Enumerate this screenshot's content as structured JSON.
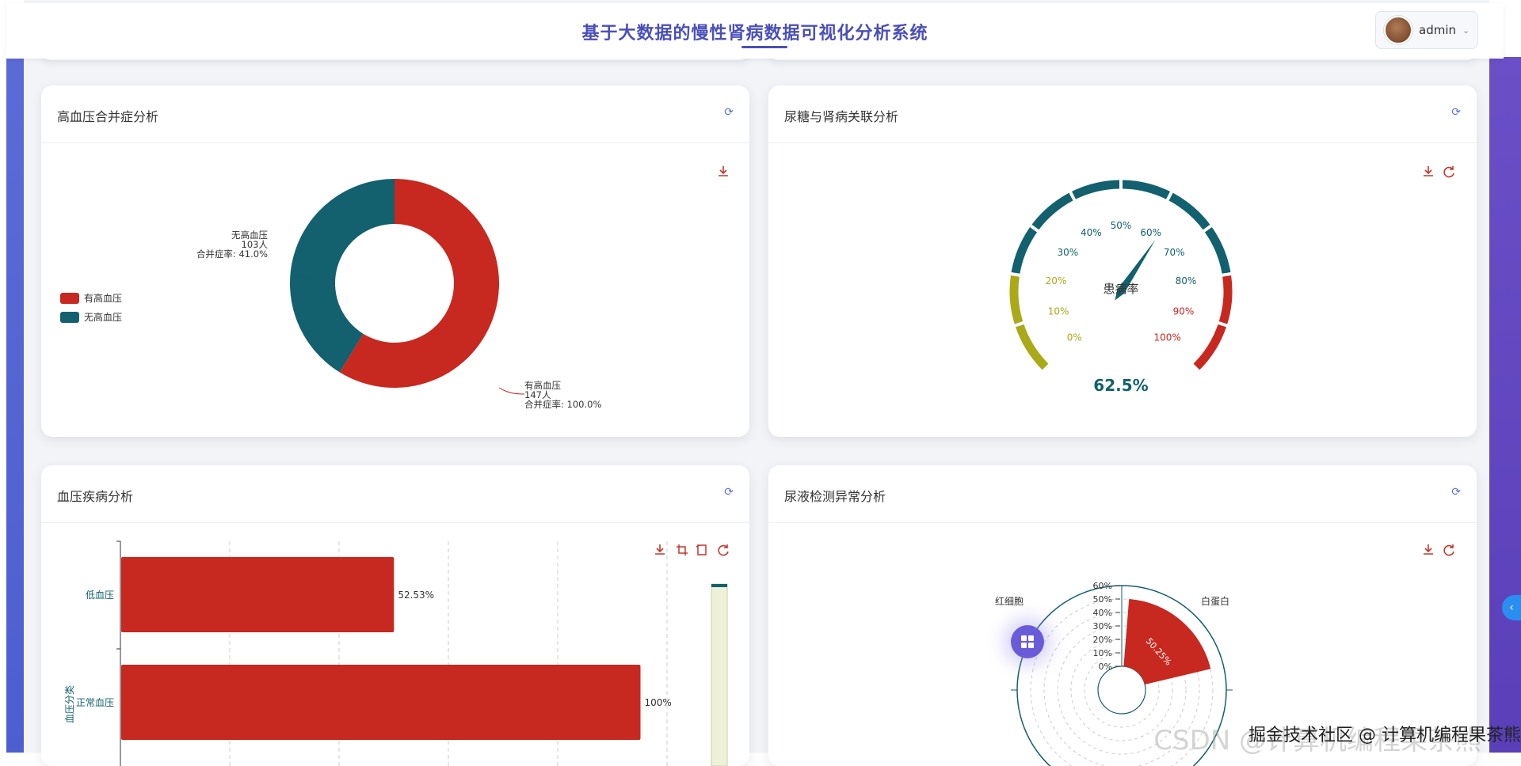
{
  "header": {
    "title": "基于大数据的慢性肾病数据可视化分析系统",
    "user_name": "admin"
  },
  "cards": {
    "hypertension": {
      "title": "高血压合并症分析",
      "legend": [
        {
          "label": "有高血压",
          "color": "#c7281f"
        },
        {
          "label": "无高血压",
          "color": "#13606e"
        }
      ],
      "labels": {
        "yes_name": "有高血压",
        "yes_count": "147人",
        "yes_rate": "合并症率: 100.0%",
        "no_name": "无高血压",
        "no_count": "103人",
        "no_rate": "合并症率: 41.0%"
      }
    },
    "glucose": {
      "title": "尿糖与肾病关联分析",
      "gauge_label": "患病率",
      "value_text": "62.5%",
      "ticks": [
        "0%",
        "10%",
        "20%",
        "30%",
        "40%",
        "50%",
        "60%",
        "70%",
        "80%",
        "90%",
        "100%"
      ]
    },
    "bp_disease": {
      "title": "血压疾病分析",
      "axis_title": "血压分类",
      "bars": [
        {
          "label": "低血压",
          "value_text": "52.53%"
        },
        {
          "label": "正常血压",
          "value_text": "100%"
        }
      ]
    },
    "urine": {
      "title": "尿液检测异常分析",
      "radial_labels": [
        "60%",
        "50%",
        "40%",
        "30%",
        "20%",
        "10%",
        "0%"
      ],
      "categories": [
        "红细胞",
        "白蛋白"
      ],
      "sector_label": "50.25%"
    }
  },
  "watermark": "掘金技术社区 @ 计算机编程果茶熊",
  "colors": {
    "red": "#c7281f",
    "teal": "#13606e",
    "olive": "#a9a91a",
    "accent": "#4a4fb8"
  },
  "icons": [
    "refresh-icon",
    "download-icon",
    "zoom-icon",
    "zoom-reset-icon",
    "restore-icon",
    "grid-icon",
    "chevron-left-icon",
    "chevron-down-icon"
  ],
  "chart_data": [
    {
      "type": "pie",
      "title": "高血压合并症分析",
      "categories": [
        "有高血压",
        "无高血压"
      ],
      "values": [
        147,
        103
      ],
      "rates": [
        "100.0%",
        "41.0%"
      ],
      "legend_position": "left"
    },
    {
      "type": "gauge",
      "title": "尿糖与肾病关联分析",
      "series": [
        {
          "name": "患病率",
          "value": 62.5
        }
      ],
      "range": [
        0,
        100
      ]
    },
    {
      "type": "bar",
      "title": "血压疾病分析",
      "ylabel": "血压分类",
      "categories": [
        "低血压",
        "正常血压"
      ],
      "values": [
        52.53,
        100
      ],
      "xlim": [
        0,
        100
      ]
    },
    {
      "type": "polar-bar",
      "title": "尿液检测异常分析",
      "categories": [
        "白蛋白"
      ],
      "values": [
        50.25
      ],
      "rlim": [
        0,
        60
      ]
    }
  ]
}
